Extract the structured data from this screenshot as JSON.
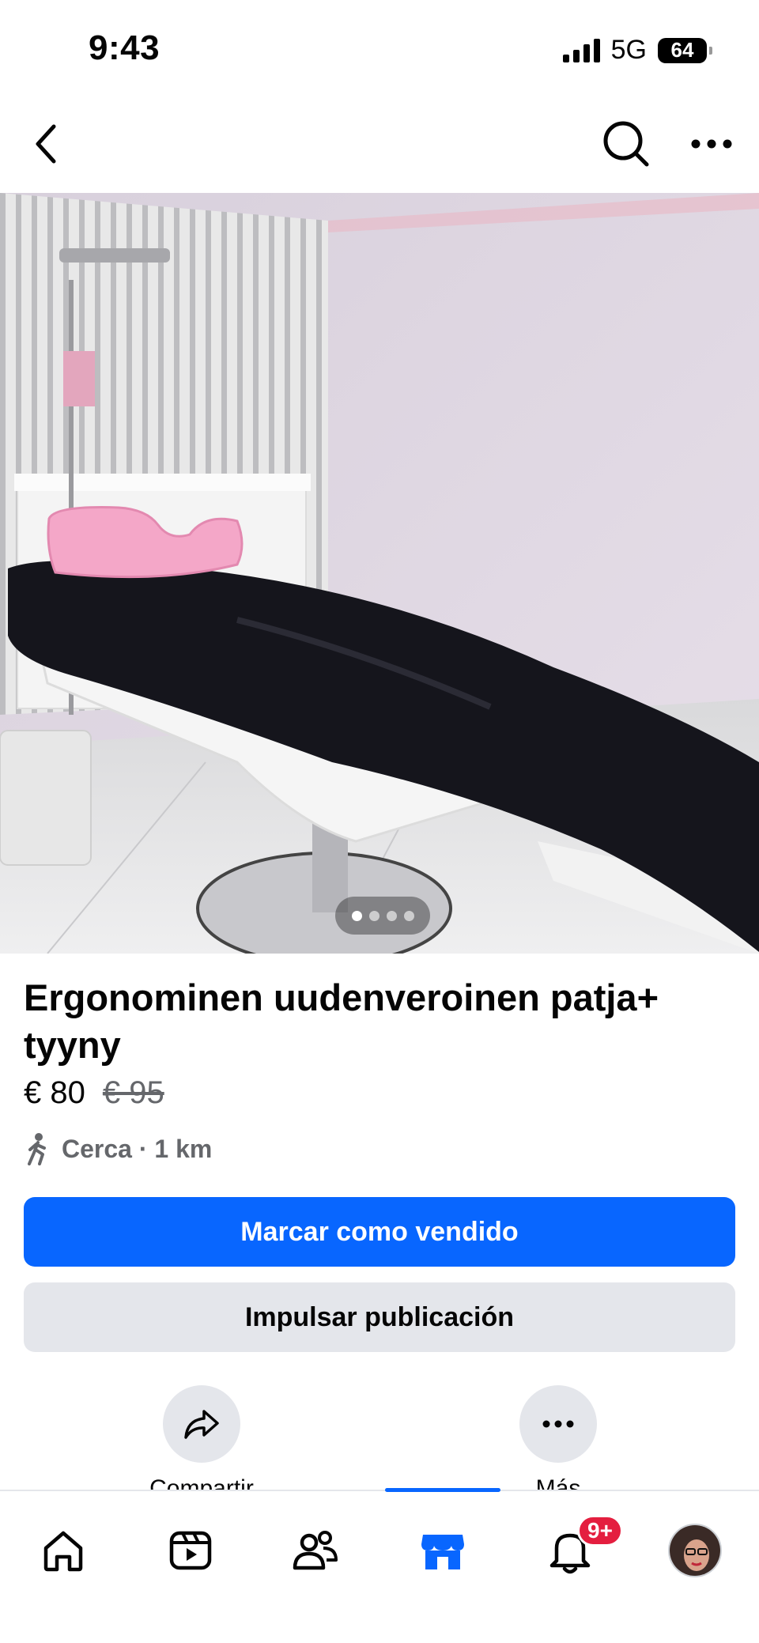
{
  "status_bar": {
    "time": "9:43",
    "network": "5G",
    "battery": "64"
  },
  "top_nav": {
    "back_icon": "chevron-left-icon",
    "search_icon": "search-icon",
    "more_icon": "more-horizontal-icon"
  },
  "photo": {
    "page_count": 4,
    "active_index": 0
  },
  "listing": {
    "title": "Ergonominen uudenveroinen patja+ tyyny",
    "price": "€ 80",
    "old_price": "€ 95",
    "location": "Cerca · 1 km"
  },
  "buttons": {
    "mark_sold": "Marcar como vendido",
    "boost": "Impulsar publicación"
  },
  "actions": {
    "share_label": "Compartir",
    "more_label": "Más"
  },
  "tabbar": {
    "active_tab": "marketplace",
    "notifications_badge": "9+",
    "tabs": [
      "home",
      "video",
      "friends",
      "marketplace",
      "notifications",
      "profile"
    ]
  },
  "colors": {
    "accent": "#0866ff",
    "secondary_button": "#e4e6eb",
    "badge": "#e41e3f",
    "muted_text": "#65676b"
  }
}
